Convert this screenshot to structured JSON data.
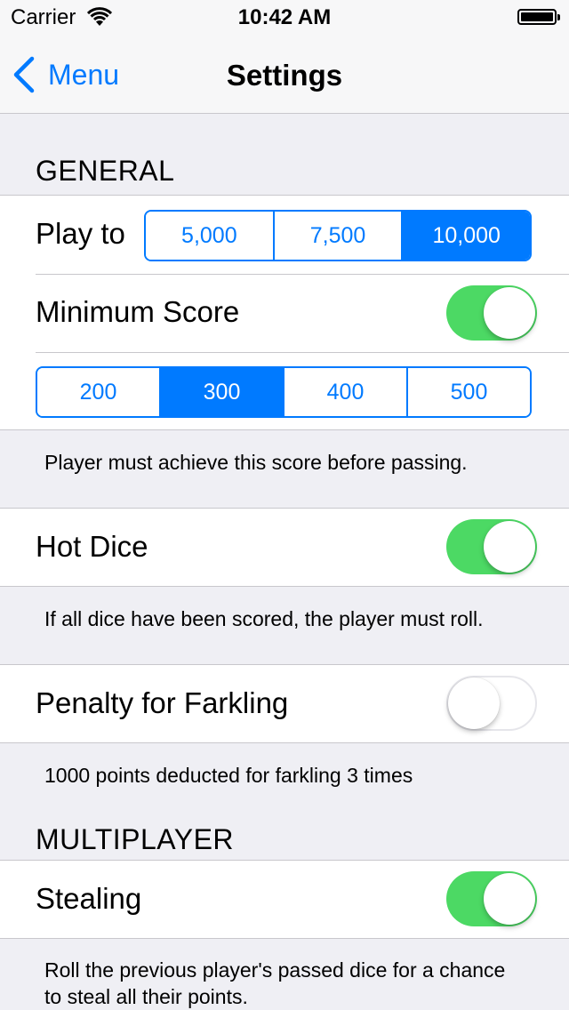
{
  "status_bar": {
    "carrier": "Carrier",
    "time": "10:42 AM"
  },
  "nav": {
    "back_label": "Menu",
    "title": "Settings"
  },
  "colors": {
    "accent": "#007aff",
    "switch_on": "#4cd964",
    "background": "#efeff4"
  },
  "general": {
    "header": "GENERAL",
    "play_to": {
      "label": "Play to",
      "options": [
        "5,000",
        "7,500",
        "10,000"
      ],
      "selected": "10,000"
    },
    "minimum_score": {
      "label": "Minimum Score",
      "enabled": true,
      "options": [
        "200",
        "300",
        "400",
        "500"
      ],
      "selected": "300",
      "footer": "Player must achieve this score before passing."
    },
    "hot_dice": {
      "label": "Hot Dice",
      "enabled": true,
      "footer": "If all dice have been scored, the player must roll."
    },
    "penalty": {
      "label": "Penalty for Farkling",
      "enabled": false,
      "footer": "1000 points deducted for farkling 3 times"
    }
  },
  "multiplayer": {
    "header": "MULTIPLAYER",
    "stealing": {
      "label": "Stealing",
      "enabled": true,
      "footer": "Roll the previous player's passed dice for a chance to steal all their points."
    }
  }
}
